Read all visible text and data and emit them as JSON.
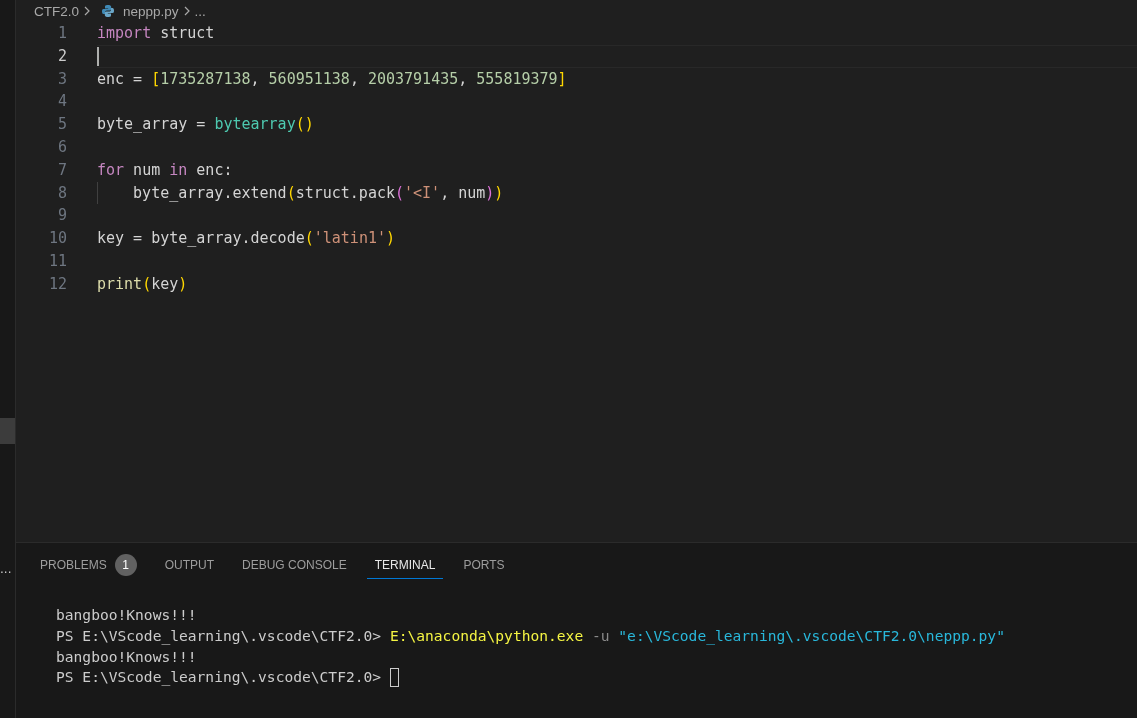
{
  "breadcrumb": [
    {
      "kind": "folder",
      "label": "CTF2.0"
    },
    {
      "kind": "file",
      "label": "neppp.py"
    },
    {
      "kind": "more",
      "label": "..."
    }
  ],
  "sidebar": {
    "more_label": "..."
  },
  "editor": {
    "lines": [
      {
        "number": "1",
        "current": false,
        "tokens": [
          {
            "kind": "keyword",
            "text": "import"
          },
          {
            "kind": "plain",
            "text": " struct"
          }
        ]
      },
      {
        "number": "2",
        "current": true
      },
      {
        "number": "3",
        "current": false,
        "tokens": [
          {
            "kind": "plain",
            "text": "enc = "
          },
          {
            "kind": "bracket",
            "text": "["
          },
          {
            "kind": "number",
            "text": "1735287138"
          },
          {
            "kind": "plain",
            "text": ", "
          },
          {
            "kind": "number",
            "text": "560951138"
          },
          {
            "kind": "plain",
            "text": ", "
          },
          {
            "kind": "number",
            "text": "2003791435"
          },
          {
            "kind": "plain",
            "text": ", "
          },
          {
            "kind": "number",
            "text": "555819379"
          },
          {
            "kind": "bracket",
            "text": "]"
          }
        ]
      },
      {
        "number": "4",
        "current": false
      },
      {
        "number": "5",
        "current": false,
        "tokens": [
          {
            "kind": "plain",
            "text": "byte_array = "
          },
          {
            "kind": "builtin",
            "text": "bytearray"
          },
          {
            "kind": "bracket",
            "text": "()"
          }
        ]
      },
      {
        "number": "6",
        "current": false
      },
      {
        "number": "7",
        "current": false,
        "tokens": [
          {
            "kind": "keyword",
            "text": "for"
          },
          {
            "kind": "plain",
            "text": " num "
          },
          {
            "kind": "keyword",
            "text": "in"
          },
          {
            "kind": "plain",
            "text": " enc:"
          }
        ]
      },
      {
        "number": "8",
        "current": false,
        "tokens": [
          {
            "kind": "indent"
          },
          {
            "kind": "plain",
            "text": "byte_array.extend"
          },
          {
            "kind": "bracket",
            "text": "("
          },
          {
            "kind": "plain",
            "text": "struct.pack"
          },
          {
            "kind": "bracket2",
            "text": "("
          },
          {
            "kind": "string",
            "text": "'<I'"
          },
          {
            "kind": "plain",
            "text": ", num"
          },
          {
            "kind": "bracket2",
            "text": ")"
          },
          {
            "kind": "bracket",
            "text": ")"
          }
        ]
      },
      {
        "number": "9",
        "current": false
      },
      {
        "number": "10",
        "current": false,
        "tokens": [
          {
            "kind": "plain",
            "text": "key = byte_array.decode"
          },
          {
            "kind": "bracket",
            "text": "("
          },
          {
            "kind": "string",
            "text": "'latin1'"
          },
          {
            "kind": "bracket",
            "text": ")"
          }
        ]
      },
      {
        "number": "11",
        "current": false
      },
      {
        "number": "12",
        "current": false,
        "tokens": [
          {
            "kind": "function",
            "text": "print"
          },
          {
            "kind": "bracket",
            "text": "("
          },
          {
            "kind": "plain",
            "text": "key"
          },
          {
            "kind": "bracket",
            "text": ")"
          }
        ]
      }
    ]
  },
  "panel": {
    "tabs": [
      {
        "label": "PROBLEMS",
        "badge": "1",
        "selected": false
      },
      {
        "label": "OUTPUT",
        "selected": false
      },
      {
        "label": "DEBUG CONSOLE",
        "selected": false
      },
      {
        "label": "TERMINAL",
        "selected": true
      },
      {
        "label": "PORTS",
        "selected": false
      }
    ],
    "terminal": [
      [
        {
          "kind": "output",
          "text": "bangboo!Knows!!!"
        }
      ],
      [
        {
          "kind": "prompt",
          "text": "PS E:\\VScode_learning\\.vscode\\CTF2.0> "
        },
        {
          "kind": "command",
          "text": "E:\\anaconda\\python.exe"
        },
        {
          "kind": "flag",
          "text": " -u "
        },
        {
          "kind": "arg",
          "text": "\"e:\\VScode_learning\\.vscode\\CTF2.0\\neppp.py\""
        }
      ],
      [
        {
          "kind": "output",
          "text": "bangboo!Knows!!!"
        }
      ],
      [
        {
          "kind": "prompt",
          "text": "PS E:\\VScode_learning\\.vscode\\CTF2.0> "
        },
        {
          "kind": "cursor"
        }
      ]
    ]
  }
}
